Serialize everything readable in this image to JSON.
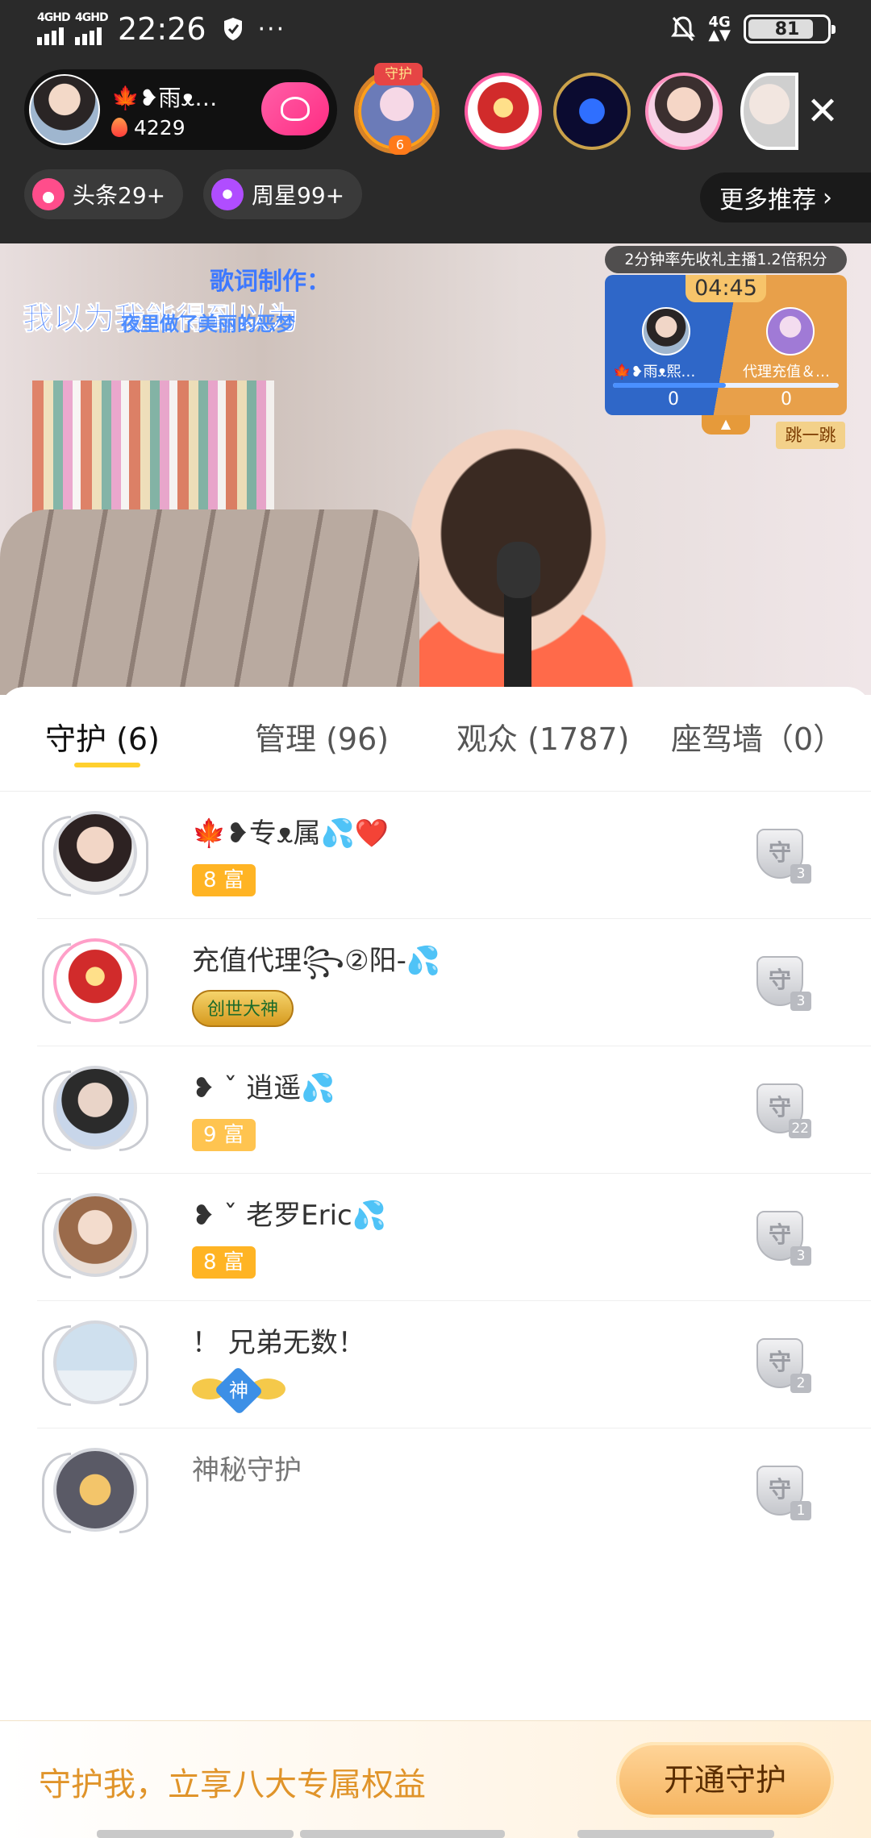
{
  "status_bar": {
    "signal_1": "4GHD",
    "signal_2": "4GHD",
    "time": "22:26",
    "dots": "···",
    "network": "4G",
    "battery": "81"
  },
  "host": {
    "name": "🍁❥雨ᴥ…",
    "fans": "4229"
  },
  "chips": {
    "headline": "头条29+",
    "weekly_star": "周星99+",
    "more": "更多推荐"
  },
  "top_viewers": {
    "guard_tag": "守护",
    "guard_count": "6"
  },
  "video": {
    "lyrics_credit": "歌词制作：",
    "lyrics_line": "我以为我能得到以为",
    "lyrics_sub": "夜里做了美丽的恶梦"
  },
  "pk": {
    "title": "2分钟率先收礼主播1.2倍积分",
    "timer": "04:45",
    "left_name": "🍁❥雨ᴥ熙…",
    "right_name": "代理充值＆…",
    "left_score": "0",
    "right_score": "0",
    "jump": "跳一跳"
  },
  "tabs": [
    {
      "label": "守护 (6)"
    },
    {
      "label": "管理 (96)"
    },
    {
      "label": "观众 (1787)"
    },
    {
      "label": "座驾墙（0）"
    }
  ],
  "guards": [
    {
      "name": "🍁❥专ᴥ属💦❤️",
      "badge": "8 富",
      "shield": "守",
      "level": "3"
    },
    {
      "name": "充值代理꧂②阳-💦",
      "badge": "创世大神",
      "shield": "守",
      "level": "3"
    },
    {
      "name": "❥ ˇ 逍遥💦",
      "badge": "9 富",
      "shield": "守",
      "level": "22"
    },
    {
      "name": "❥ ˇ 老罗Eric💦",
      "badge": "8 富",
      "shield": "守",
      "level": "3"
    },
    {
      "name": "！ 兄弟无数！",
      "badge": "神",
      "shield": "守",
      "level": "2"
    },
    {
      "name": "神秘守护",
      "badge": "",
      "shield": "守",
      "level": "1"
    }
  ],
  "footer": {
    "text": "守护我，立享八大专属权益",
    "button": "开通守护"
  }
}
